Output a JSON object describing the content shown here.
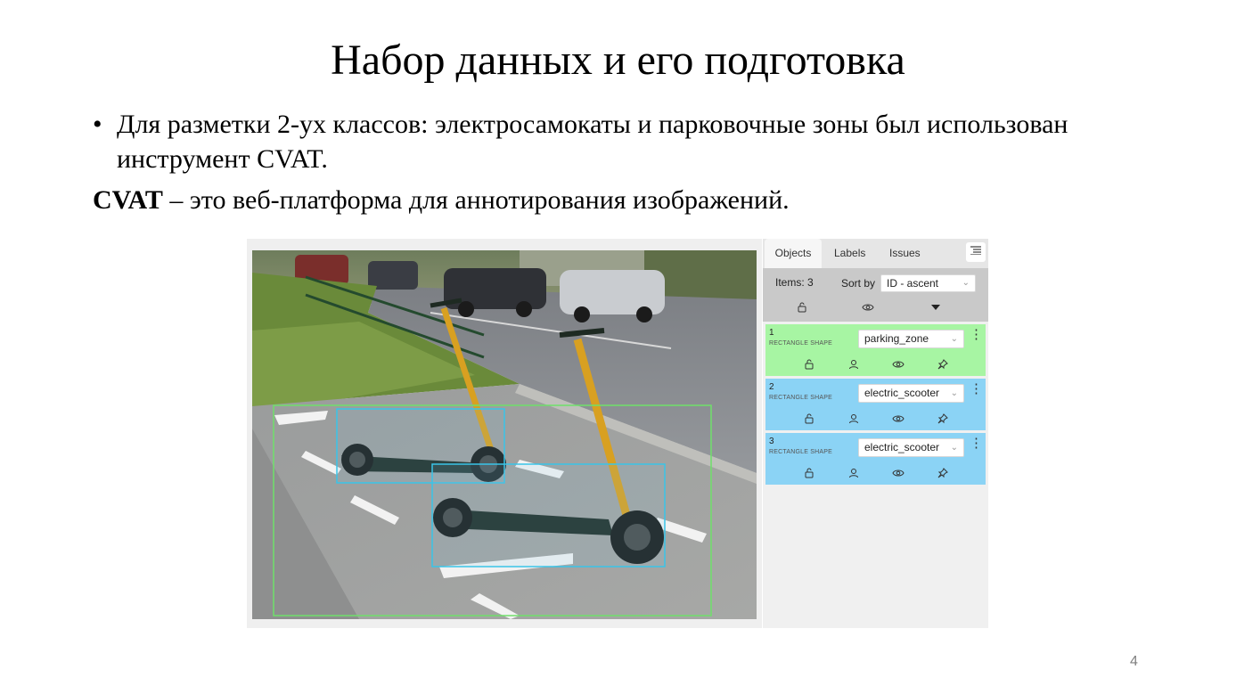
{
  "slide": {
    "title": "Набор данных и его подготовка",
    "bullet_symbol": "•",
    "bullet_text": "Для разметки 2-ух классов: электросамокаты и парковочные зоны был использован инструмент CVAT.",
    "cvat_bold": "CVAT",
    "cvat_rest": " – это веб-платформа для аннотирования изображений.",
    "page_number": "4"
  },
  "sidebar": {
    "tabs": [
      "Objects",
      "Labels",
      "Issues"
    ],
    "active_tab": "Objects",
    "items_count": "Items: 3",
    "sort_label": "Sort by",
    "sort_value": "ID - ascent",
    "objects": [
      {
        "id": "1",
        "kind": "RECTANGLE SHAPE",
        "label": "parking_zone",
        "color": "#a7f5a3"
      },
      {
        "id": "2",
        "kind": "RECTANGLE SHAPE",
        "label": "electric_scooter",
        "color": "#8bd3f5"
      },
      {
        "id": "3",
        "kind": "RECTANGLE SHAPE",
        "label": "electric_scooter",
        "color": "#8bd3f5"
      }
    ],
    "icons": [
      "lock-icon",
      "eye-icon",
      "caret-down-icon",
      "person-icon",
      "pin-icon",
      "list-menu-icon"
    ]
  }
}
